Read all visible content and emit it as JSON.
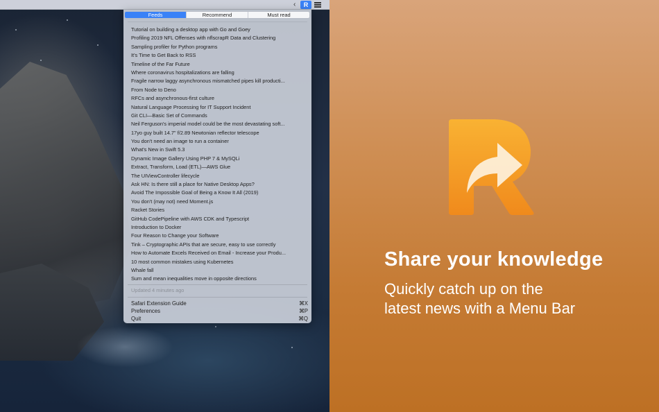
{
  "menubar": {
    "chevron": "‹",
    "app_icon_letter": "R"
  },
  "panel": {
    "tabs": [
      {
        "label": "Feeds",
        "active": true
      },
      {
        "label": "Recommend",
        "active": false
      },
      {
        "label": "Must read",
        "active": false
      }
    ],
    "items": [
      "Tutorial on building a desktop app with Go and Goey",
      "Profiling 2019 NFL Offenses with nflscrapR Data and Clustering",
      "Sampling profiler for Python programs",
      "It's Time to Get Back to RSS",
      "Timeline of the Far Future",
      "Where coronavirus hospitalizations are falling",
      "Fragile narrow laggy asynchronous mismatched pipes kill producti...",
      "From Node to Deno",
      "RFCs and asynchronous-first culture",
      "Natural Language Processing for IT Support Incident",
      "Git CLI—Basic Set of Commands",
      "Neil Ferguson's imperial model could be the most devastating soft...",
      "17yo guy built 14.7\" f/2.89 Newtonian reflector telescope",
      "You don't need an image to run a container",
      "What's New in Swift 5.3",
      "Dynamic Image Gallery Using PHP 7 & MySQLi",
      "Extract, Transform, Load (ETL)—AWS Glue",
      "The UIViewController lifecycle",
      "Ask HN: Is there still a place for Native Desktop Apps?",
      "Avoid The Impossible Goal of Being a Know It All (2019)",
      "You don't (may not) need Moment.js",
      "Racket Stories",
      "GitHub CodePipeline with AWS CDK and Typescript",
      "Introduction to Docker",
      "Four Reason to Change your Software",
      "Tink – Cryptographic APIs that are secure, easy to use correctly",
      "How to Automate Excels Received on Email - Increase your Produ...",
      "10 most common mistakes using Kubernetes",
      "Whale fall",
      "Sum and mean inequalities move in opposite directions"
    ],
    "updated": "Updated 4 minutes ago",
    "menu": [
      {
        "label": "Safari Extension Guide",
        "shortcut": "⌘X"
      },
      {
        "label": "Preferences",
        "shortcut": "⌘P"
      },
      {
        "label": "Quit",
        "shortcut": "⌘Q"
      }
    ]
  },
  "promo": {
    "headline": "Share your knowledge",
    "subline_1": "Quickly catch up on the",
    "subline_2": "latest news with a Menu Bar",
    "logo_icon": "r-share-arrow-logo",
    "logo_color_top": "#f9b233",
    "logo_color_bottom": "#f08a1c"
  }
}
